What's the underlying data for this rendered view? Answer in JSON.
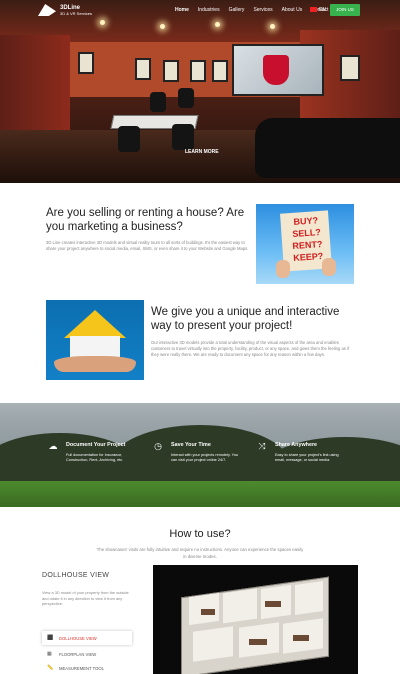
{
  "header": {
    "logo_name": "3DLine",
    "logo_tagline": "3D & VR Services",
    "nav": [
      "Home",
      "Industries",
      "Gallery",
      "Services",
      "About Us",
      "Contact"
    ],
    "language": "EN",
    "join_label": "JOIN US",
    "join_color": "#37b24d"
  },
  "hero": {
    "cta_label": "LEARN MORE"
  },
  "section1": {
    "title": "Are you selling or renting a house? Are you marketing a business?",
    "text": "3D Line creates interactive 3D models and virtual reality tours to all sorts of buildings. It's the easiest way to share your project anywhere to social media, email, SMS, or even share it to your Website and Google Maps.",
    "image_sign_text": "BUY? SELL? RENT? KEEP?"
  },
  "section2": {
    "title": "We give you a unique and interactive way to present your project!",
    "text": "Our interactive 3D models provide a total understanding of the visual aspects of the area and enables customers to travel virtually into the property, facility, product, or any space, and gives them the feeling as if they were really there. We are ready to document any space for any reason within a few days."
  },
  "features": [
    {
      "icon": "cloud-upload-icon",
      "title": "Document Your Project",
      "text": "Full documentation for Insurance, Construction, Rent, Archiving, etc."
    },
    {
      "icon": "clock-icon",
      "title": "Save Your Time",
      "text": "Interact with your projects remotely. You can visit your project online 24/7."
    },
    {
      "icon": "share-icon",
      "title": "Share Anywhere",
      "text": "Easy to share your project's link using email, message, or social media."
    }
  ],
  "how_to_use": {
    "title": "How to use?",
    "subtitle": "The showcases' visits are fully intuitive and require no instructions. Anyone can experience the spaces easily in diverse modes.",
    "mode_title": "DOLLHOUSE VIEW",
    "mode_description": "View a 3D model of your property from the outside and rotate it in any direction to view it from any perspective.",
    "modes": [
      {
        "label": "DOLLHOUSE VIEW",
        "icon": "cube-icon",
        "active": true
      },
      {
        "label": "FLOORPLAN VIEW",
        "icon": "floorplan-icon",
        "active": false
      },
      {
        "label": "MEASUREMENT TOOL",
        "icon": "ruler-icon",
        "active": false
      }
    ],
    "accent_color": "#d9342b"
  }
}
